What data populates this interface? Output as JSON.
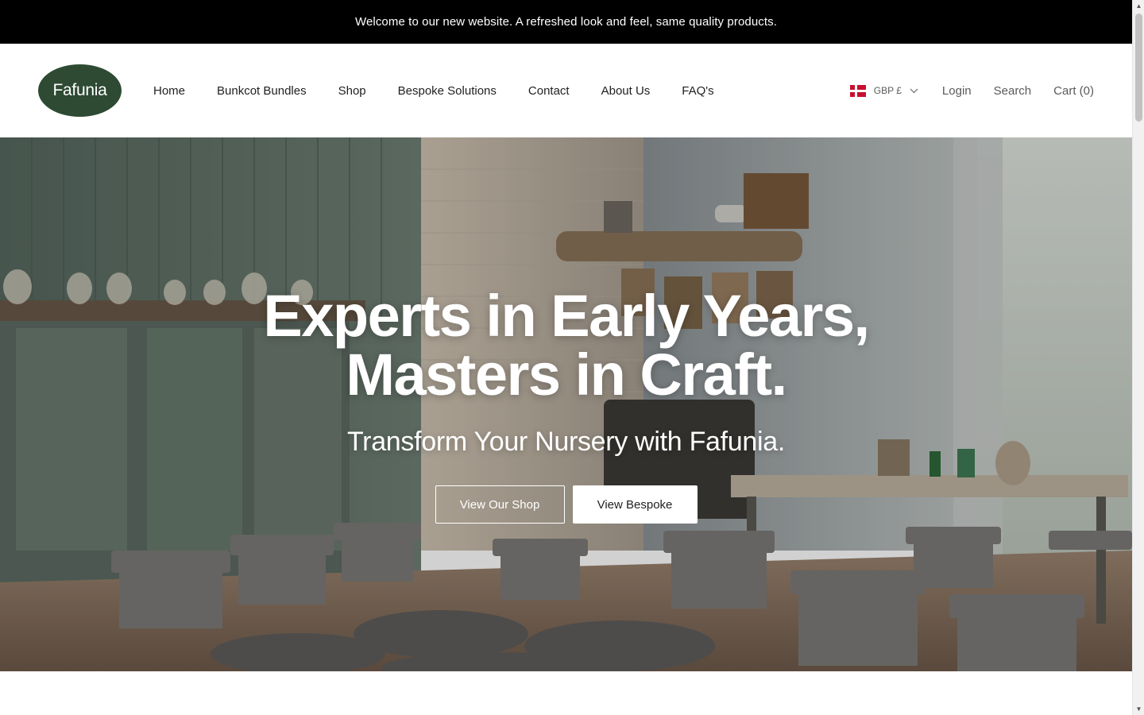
{
  "announcement": {
    "text": "Welcome to our new website. A refreshed look and feel, same quality products."
  },
  "header": {
    "logo_text": "Fafunia",
    "nav": [
      {
        "label": "Home"
      },
      {
        "label": "Bunkcot Bundles"
      },
      {
        "label": "Shop"
      },
      {
        "label": "Bespoke Solutions"
      },
      {
        "label": "Contact"
      },
      {
        "label": "About Us"
      },
      {
        "label": "FAQ's"
      }
    ],
    "currency": {
      "label": "GBP £",
      "flag_icon": "denmark-flag-icon"
    },
    "login_label": "Login",
    "search_label": "Search",
    "cart_label": "Cart (0)"
  },
  "hero": {
    "title_line1": "Experts in Early Years,",
    "title_line2": "Masters in Craft.",
    "subtitle": "Transform Your Nursery with Fafunia.",
    "shop_button": "View Our Shop",
    "bespoke_button": "View Bespoke"
  },
  "colors": {
    "announcement_bg": "#000000",
    "logo_bg": "#2e4a33",
    "text_primary": "#1f1f1f",
    "text_secondary": "#5a5a5a"
  }
}
